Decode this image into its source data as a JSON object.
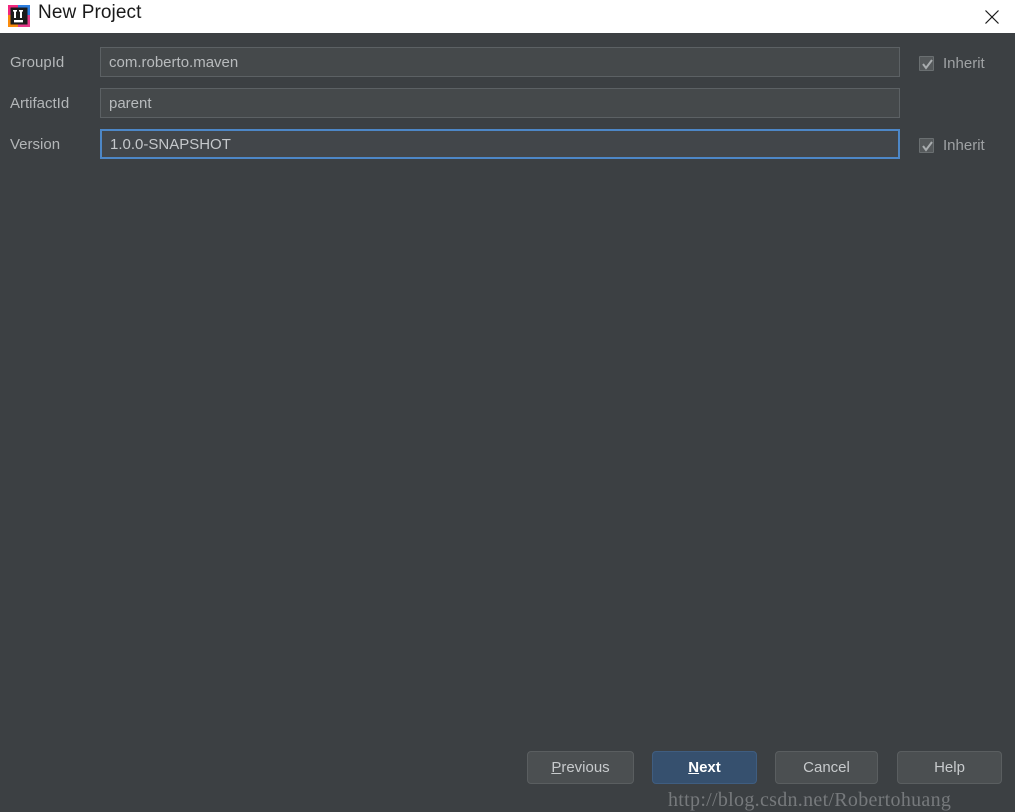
{
  "window": {
    "title": "New Project",
    "app_icon": "intellij-idea-logo",
    "close_icon": "close-icon",
    "titlebar_bg": "#ffffff",
    "body_bg": "#3c4043"
  },
  "form": {
    "rows": [
      {
        "label": "GroupId",
        "value": "com.roberto.maven",
        "placeholder": "",
        "focused": false,
        "inherit": {
          "label": "Inherit",
          "checked": true,
          "disabled": true
        }
      },
      {
        "label": "ArtifactId",
        "value": "parent",
        "placeholder": "",
        "focused": false,
        "inherit": null
      },
      {
        "label": "Version",
        "value": "1.0.0-SNAPSHOT",
        "placeholder": "",
        "focused": true,
        "inherit": {
          "label": "Inherit",
          "checked": true,
          "disabled": true
        }
      }
    ]
  },
  "buttons": {
    "previous": {
      "label": "Previous",
      "mnemonic": "P",
      "rest": "revious"
    },
    "next": {
      "label": "Next",
      "mnemonic": "N",
      "rest": "ext",
      "default": true
    },
    "cancel": {
      "label": "Cancel"
    },
    "help": {
      "label": "Help"
    }
  },
  "watermark": {
    "text": "http://blog.csdn.net/Robertohuang"
  },
  "colors": {
    "accent_focus": "#4d87c7",
    "default_button": "#36506e",
    "button_face": "#4b4f51",
    "field_face": "#45494b",
    "text_primary": "#b8bbbd"
  }
}
